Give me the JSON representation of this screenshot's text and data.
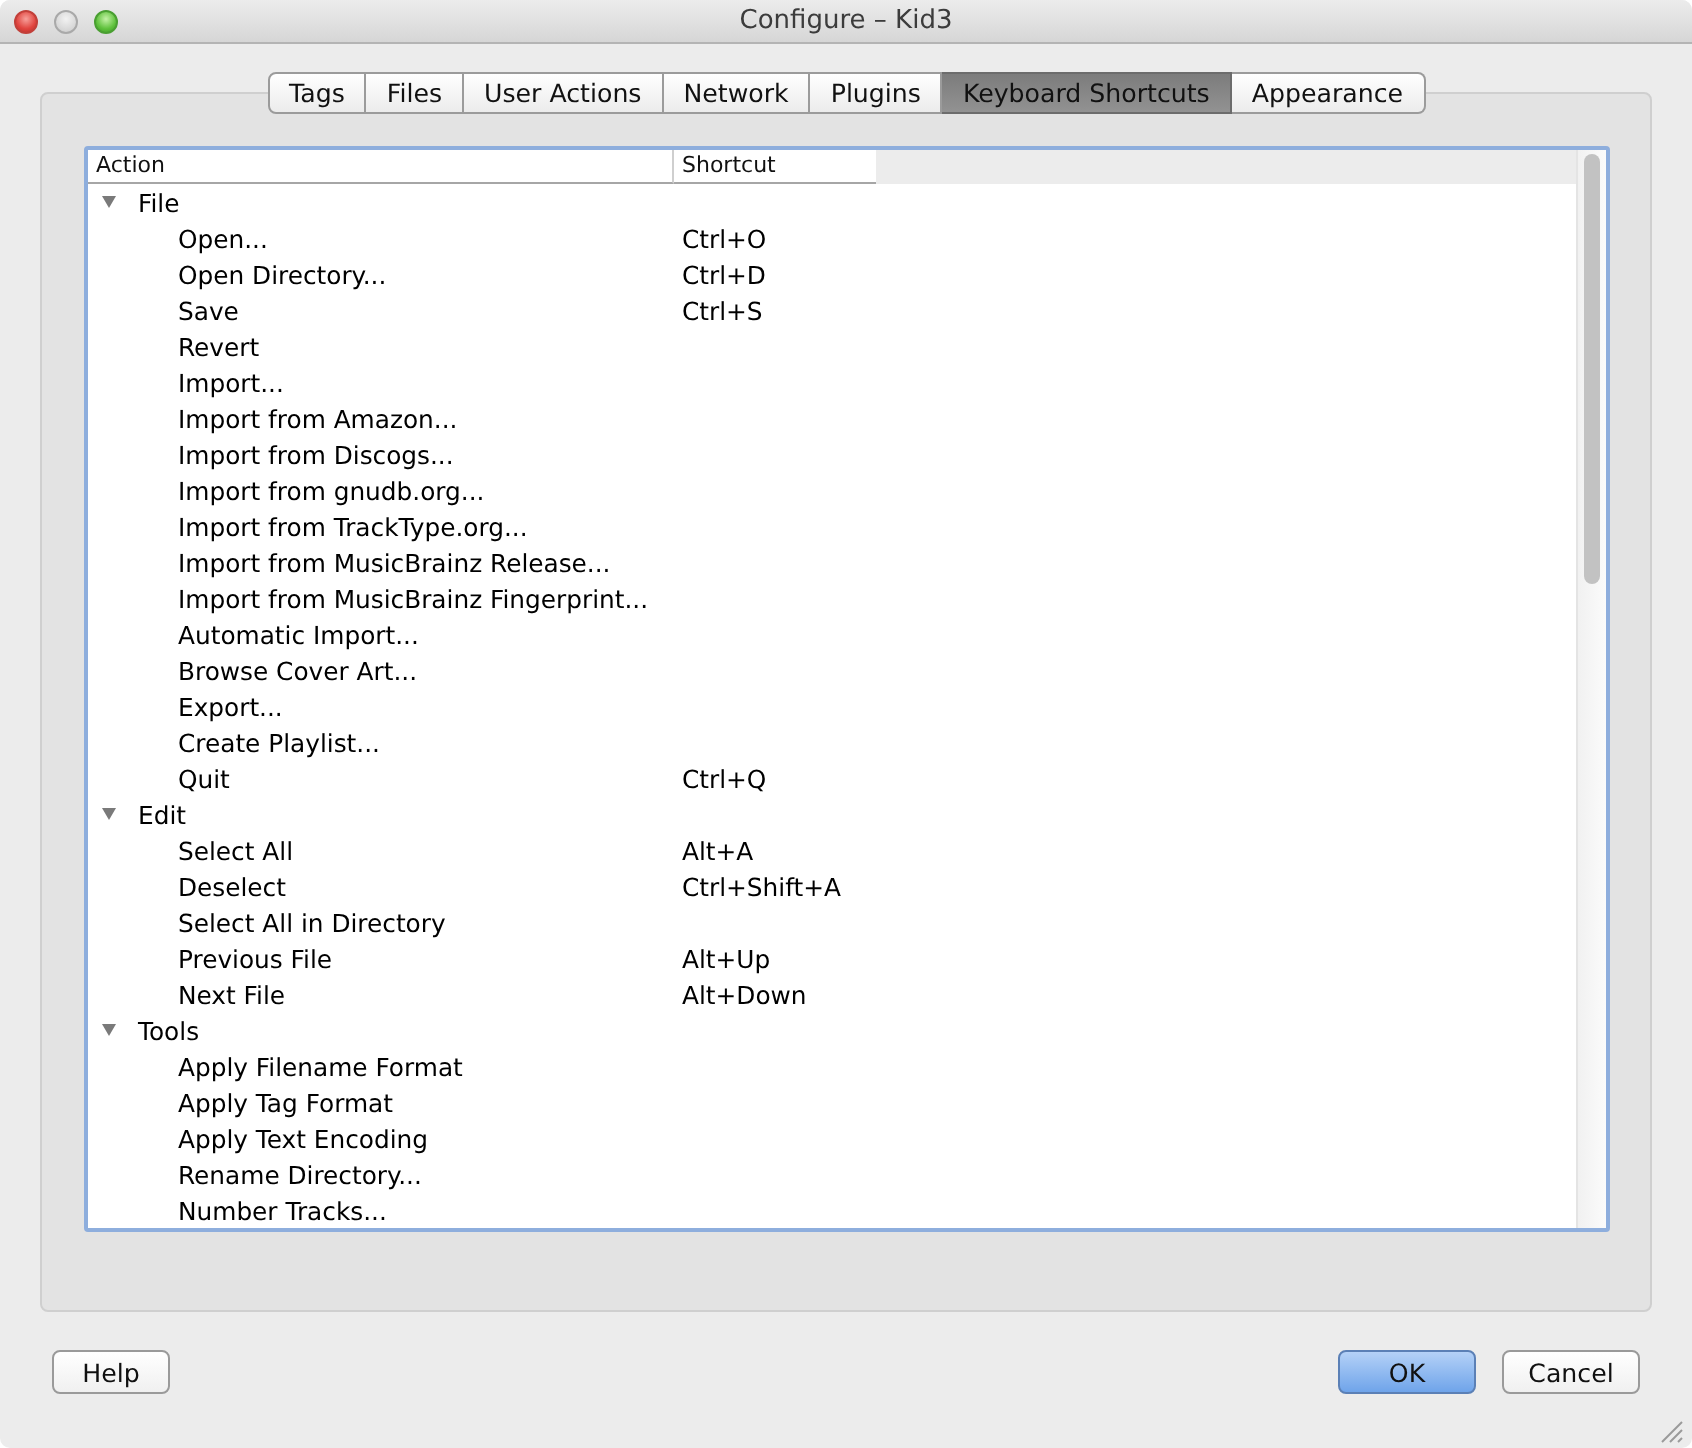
{
  "window": {
    "title": "Configure – Kid3"
  },
  "tabs": [
    {
      "label": "Tags",
      "selected": false
    },
    {
      "label": "Files",
      "selected": false
    },
    {
      "label": "User Actions",
      "selected": false
    },
    {
      "label": "Network",
      "selected": false
    },
    {
      "label": "Plugins",
      "selected": false
    },
    {
      "label": "Keyboard Shortcuts",
      "selected": true
    },
    {
      "label": "Appearance",
      "selected": false
    }
  ],
  "shortcuts": {
    "columns": [
      "Action",
      "Shortcut"
    ],
    "groups": [
      {
        "label": "File",
        "expanded": true,
        "children": [
          {
            "action": "Open...",
            "shortcut": "Ctrl+O"
          },
          {
            "action": "Open Directory...",
            "shortcut": "Ctrl+D"
          },
          {
            "action": "Save",
            "shortcut": "Ctrl+S"
          },
          {
            "action": "Revert"
          },
          {
            "action": "Import..."
          },
          {
            "action": "Import from Amazon..."
          },
          {
            "action": "Import from Discogs..."
          },
          {
            "action": "Import from gnudb.org..."
          },
          {
            "action": "Import from TrackType.org..."
          },
          {
            "action": "Import from MusicBrainz Release..."
          },
          {
            "action": "Import from MusicBrainz Fingerprint..."
          },
          {
            "action": "Automatic Import..."
          },
          {
            "action": "Browse Cover Art..."
          },
          {
            "action": "Export..."
          },
          {
            "action": "Create Playlist..."
          },
          {
            "action": "Quit",
            "shortcut": "Ctrl+Q"
          }
        ]
      },
      {
        "label": "Edit",
        "expanded": true,
        "children": [
          {
            "action": "Select All",
            "shortcut": "Alt+A"
          },
          {
            "action": "Deselect",
            "shortcut": "Ctrl+Shift+A"
          },
          {
            "action": "Select All in Directory"
          },
          {
            "action": "Previous File",
            "shortcut": "Alt+Up"
          },
          {
            "action": "Next File",
            "shortcut": "Alt+Down"
          }
        ]
      },
      {
        "label": "Tools",
        "expanded": true,
        "children": [
          {
            "action": "Apply Filename Format"
          },
          {
            "action": "Apply Tag Format"
          },
          {
            "action": "Apply Text Encoding"
          },
          {
            "action": "Rename Directory..."
          },
          {
            "action": "Number Tracks..."
          }
        ]
      }
    ]
  },
  "help_button": {
    "label": "Help"
  },
  "dialog_buttons": [
    {
      "label": "OK",
      "default": true
    },
    {
      "label": "Cancel",
      "default": false
    }
  ]
}
